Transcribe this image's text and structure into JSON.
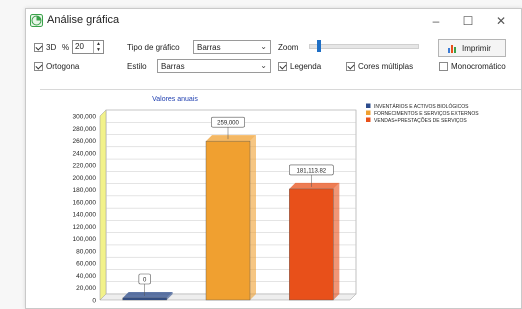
{
  "window": {
    "title": "Análise gráfica",
    "minimize": "–",
    "maximize": "☐",
    "close": "✕"
  },
  "toolbar": {
    "three_d_label": "3D",
    "three_d_checked": true,
    "percent_label": "%",
    "percent_value": "20",
    "chart_type_label": "Tipo de gráfico",
    "chart_type_value": "Barras",
    "zoom_label": "Zoom",
    "zoom_level": 0.08,
    "print_label": "Imprimir",
    "orthogonal_label": "Ortogona",
    "orthogonal_checked": true,
    "style_label": "Estilo",
    "style_value": "Barras",
    "legend_label": "Legenda",
    "legend_checked": true,
    "multi_colors_label": "Cores múltiplas",
    "multi_colors_checked": true,
    "monochrome_label": "Monocromático",
    "monochrome_checked": false
  },
  "chart_data": {
    "type": "bar",
    "title": "Valores anuais",
    "categories": [
      "INVENTÁRIOS E ACTIVOS BIOLÓGICOS",
      "FORNECIMENTOS E SERVIÇOS EXTERNOS",
      "VENDAS+PRESTAÇÕES DE SERVIÇOS"
    ],
    "values": [
      0,
      259000,
      181113.82
    ],
    "value_labels": [
      "0",
      "259,000",
      "181,113.82"
    ],
    "colors": [
      "#2c4c8c",
      "#f0a030",
      "#e8501a"
    ],
    "ylim": [
      0,
      300000
    ],
    "yticks": [
      "0",
      "20,000",
      "40,000",
      "60,000",
      "80,000",
      "100,000",
      "120,000",
      "140,000",
      "160,000",
      "180,000",
      "200,000",
      "220,000",
      "240,000",
      "260,000",
      "280,000",
      "300,000"
    ],
    "legend_position": "top-right",
    "grid": true,
    "three_d": true
  }
}
